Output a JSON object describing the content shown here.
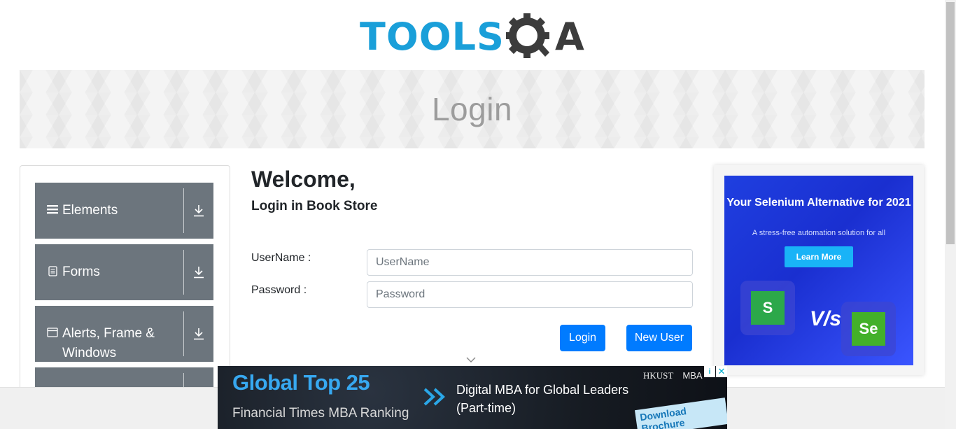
{
  "header": {
    "logo_tools": "TOOLS",
    "logo_a": "A",
    "logo_alt": "TOOLSQA"
  },
  "banner": {
    "title": "Login"
  },
  "sidebar": {
    "groups": [
      {
        "label": "Elements",
        "icon": "hamburger-icon"
      },
      {
        "label": "Forms",
        "icon": "document-icon"
      },
      {
        "label": "Alerts, Frame & Windows",
        "icon": "window-icon"
      },
      {
        "label": "",
        "icon": ""
      }
    ]
  },
  "main": {
    "welcome": "Welcome,",
    "subtitle": "Login in Book Store",
    "username_label": "UserName :",
    "username_placeholder": "UserName",
    "username_value": "",
    "password_label": "Password :",
    "password_placeholder": "Password",
    "password_value": "",
    "login_button": "Login",
    "new_user_button": "New User"
  },
  "right_ad": {
    "title": "Your Selenium Alternative for 2021",
    "subtitle": "A stress-free automation solution for all",
    "button": "Learn More",
    "left_logo": "S",
    "vs": "V/s",
    "right_logo": "Se"
  },
  "bottom_ad": {
    "title": "Global Top 25",
    "ranking": "Financial Times MBA Ranking",
    "program_line1": "Digital MBA for Global Leaders",
    "program_line2": "(Part-time)",
    "school": "HKUST",
    "degree": "MBA",
    "download": "Download Brochure",
    "close": "✕",
    "info": "i"
  },
  "colors": {
    "accent": "#007bff",
    "sidebar_group": "#6c757d",
    "logo_blue": "#1a9fd9",
    "logo_dark": "#3c3c3c"
  }
}
